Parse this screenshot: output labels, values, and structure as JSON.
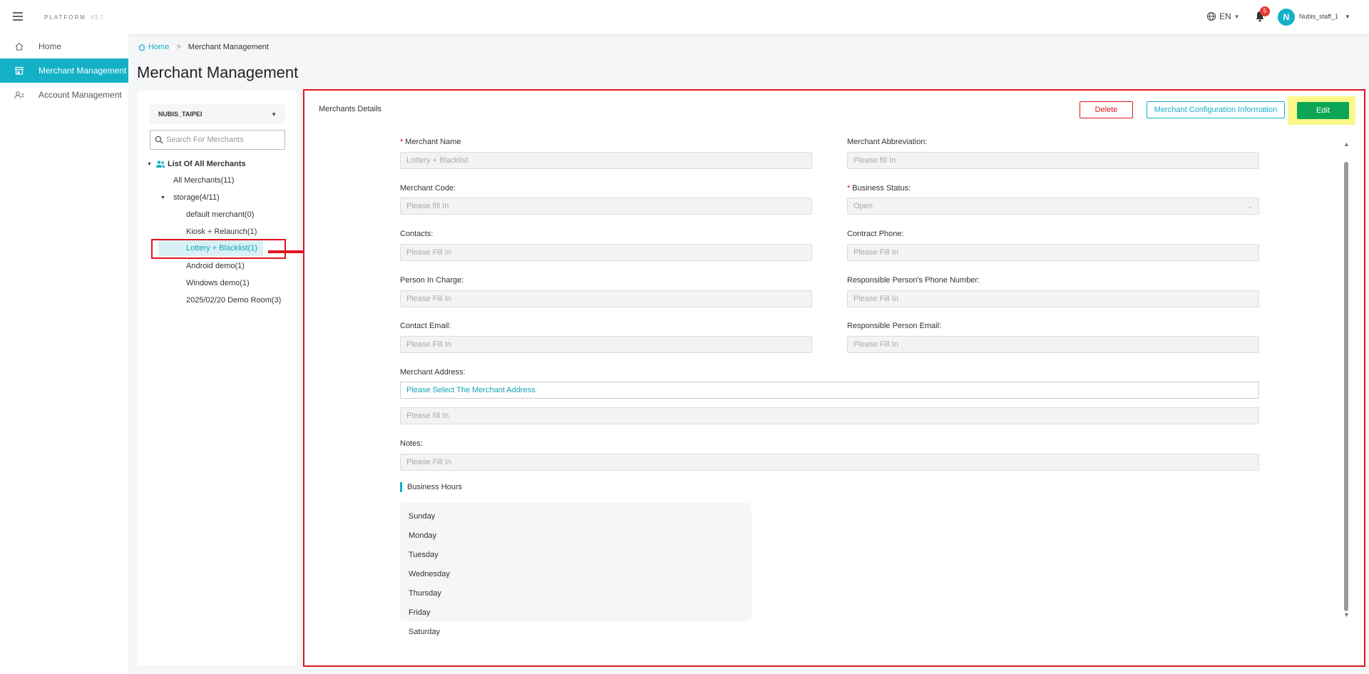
{
  "app": {
    "logo": "PLATFORM",
    "version": "V3.7"
  },
  "topbar": {
    "language": "EN",
    "notification_count": "5",
    "avatar_initial": "N",
    "username": "Nubis_staff_1"
  },
  "sidebar": {
    "items": [
      {
        "label": "Home",
        "icon": "home-icon"
      },
      {
        "label": "Merchant Management",
        "icon": "store-icon"
      },
      {
        "label": "Account Management",
        "icon": "accounts-icon"
      }
    ]
  },
  "breadcrumb": {
    "home": "Home",
    "current": "Merchant Management"
  },
  "page": {
    "title": "Merchant Management"
  },
  "tree": {
    "tenant": "NUBIS_TAIPEI",
    "search_placeholder": "Search For Merchants",
    "root_label": "List Of All Merchants",
    "all_merchants": "All Merchants(11)",
    "group": "storage(4/11)",
    "merchants": [
      "default merchant(0)",
      "Kiosk + Relaunch(1)",
      "Lottery + Blacklist(1)",
      "Android demo(1)",
      "Windows demo(1)",
      "2025/02/20 Demo Room(3)"
    ],
    "selected": "Lottery + Blacklist(1)"
  },
  "details": {
    "title": "Merchants Details",
    "buttons": {
      "delete": "Delete",
      "config": "Merchant Configuration Information",
      "edit": "Edit"
    },
    "fields": {
      "merchant_name": {
        "label": "Merchant Name",
        "value": "Lottery + Blacklist",
        "required": true
      },
      "merchant_abbreviation": {
        "label": "Merchant Abbreviation:",
        "placeholder": "Please fill In"
      },
      "merchant_code": {
        "label": "Merchant Code:",
        "placeholder": "Please fill In"
      },
      "business_status": {
        "label": "Business Status:",
        "value": "Open",
        "required": true
      },
      "contacts": {
        "label": "Contacts:",
        "placeholder": "Please Fill In"
      },
      "contract_phone": {
        "label": "Contract Phone:",
        "placeholder": "Please Fill In"
      },
      "person_in_charge": {
        "label": "Person In Charge:",
        "placeholder": "Please Fill In"
      },
      "responsible_phone": {
        "label": "Responsible Person's Phone Number:",
        "placeholder": "Please Fill In"
      },
      "contact_email": {
        "label": "Contact Email:",
        "placeholder": "Please Fill In"
      },
      "responsible_email": {
        "label": "Responsible Person Email:",
        "placeholder": "Please Fill In"
      },
      "merchant_address": {
        "label": "Merchant Address:",
        "select_text": "Please Select The Merchant Address",
        "detail_placeholder": "Please fill In"
      },
      "notes": {
        "label": "Notes:",
        "placeholder": "Please Fill In"
      }
    },
    "business_hours": {
      "title": "Business Hours",
      "days": [
        "Sunday",
        "Monday",
        "Tuesday",
        "Wednesday",
        "Thursday",
        "Friday",
        "Saturday"
      ]
    }
  },
  "colors": {
    "accent": "#13b0c6",
    "danger": "#e0141e",
    "success": "#0aa655",
    "highlight": "#fbf88a"
  }
}
